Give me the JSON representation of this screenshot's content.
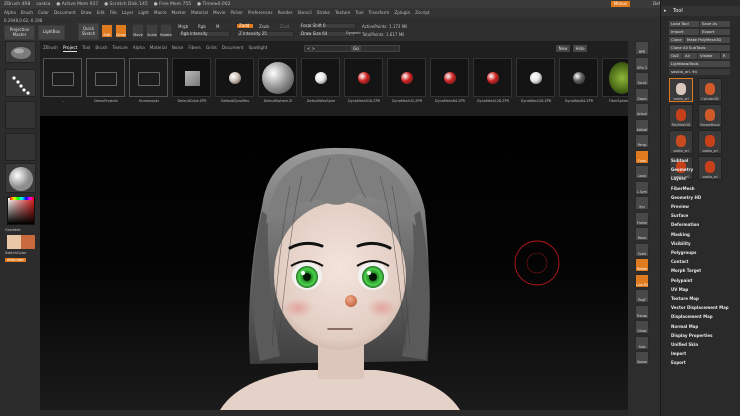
{
  "titlebar": {
    "items": [
      "ZBrush 4R8",
      "saskia",
      "● Active Mem 937",
      "● Scratch Disk 145",
      "● Free Mem 755",
      "● Timer▸0.002"
    ],
    "menus_label": "Menus",
    "script_label": "DefaultZScript"
  },
  "menubar": [
    "Alpha",
    "Brush",
    "Color",
    "Document",
    "Draw",
    "Edit",
    "File",
    "Layer",
    "Light",
    "Macro",
    "Marker",
    "Material",
    "Movie",
    "Picker",
    "Preferences",
    "Render",
    "Stencil",
    "Stroke",
    "Texture",
    "Tool",
    "Transform",
    "Zplugin",
    "Zscript"
  ],
  "shelf": {
    "coords": "0.2948,0.62,-0.198",
    "projection_master": "Projection Master",
    "lightbox": "LightBox",
    "quick_sketch": "Quick Sketch",
    "tools": [
      "Edit",
      "Draw",
      "Move",
      "Scale",
      "Rotate"
    ],
    "mrgb": "Mrgb",
    "rgb": "Rgb",
    "m": "M",
    "zadd": "Zadd",
    "zsub": "Zsub",
    "zcut": "Zcut",
    "rgb_intensity": "Rgb Intensity",
    "z_intensity": "Z Intensity 25",
    "focal_shift": "Focal Shift 0",
    "draw_size": "Draw Size 64",
    "active_points": "ActivePoints: 1.173 Mil",
    "total_points": "TotalPoints: 1.617 Mil",
    "dynamic": "Dynamic"
  },
  "left": {
    "gradient": "Gradient",
    "switch_color": "SwitchColor",
    "alternate": "Alternate"
  },
  "lightbox": {
    "tabs": [
      "ZBrush",
      "Project",
      "Tool",
      "Brush",
      "Texture",
      "Alpha",
      "Material",
      "Noise",
      "Fibers",
      "Grids",
      "Document",
      "Spotlight"
    ],
    "active_tab": "Project",
    "search": "< >",
    "go": "Go",
    "new": "New",
    "hide": "Hide",
    "thumbs": [
      {
        "label": "..",
        "kind": "folder"
      },
      {
        "label": "DemoProjects",
        "kind": "folder"
      },
      {
        "label": "Humanoyds",
        "kind": "folder"
      },
      {
        "label": "DefaultCube.ZPR",
        "kind": "cube"
      },
      {
        "label": "DefaultDynaMes",
        "kind": "ball",
        "color": "#cdbfb4"
      },
      {
        "label": "DefaultSphere.ZI",
        "kind": "bigball",
        "color": "#9c9c9c"
      },
      {
        "label": "DefaultWaxSphe",
        "kind": "ball",
        "color": "#e6e6e6"
      },
      {
        "label": "DynaMesh016.ZPR",
        "kind": "ball",
        "color": "#cc2020"
      },
      {
        "label": "DynaMesh32.ZPR",
        "kind": "ball",
        "color": "#cc2020"
      },
      {
        "label": "DynaMesh64.ZPR",
        "kind": "ball",
        "color": "#cc2020"
      },
      {
        "label": "DynaMesh128.ZPR",
        "kind": "ball",
        "color": "#cc2020"
      },
      {
        "label": "DynaWax128.ZPR",
        "kind": "ball",
        "color": "#e6e6e6"
      },
      {
        "label": "DynaWax64.ZPR",
        "kind": "ball",
        "color": "#5a5a5a"
      },
      {
        "label": "FiberSphere.ZP",
        "kind": "fiber"
      }
    ]
  },
  "rstrip": [
    "BPR",
    "SPix 3",
    "Scroll",
    "Zoom",
    "Actual",
    "AAHalf",
    "Persp",
    "Floor",
    "Local",
    "L.Sym",
    "Xyz",
    "Frame",
    "Move",
    "Scale",
    "Rotate",
    "Line Fill",
    "PolyF",
    "Transp",
    "Ghost",
    "Solo",
    "Xpose"
  ],
  "palette": {
    "title": "Tool",
    "buttons": [
      "Load Tool",
      "Save As",
      "Import",
      "Export",
      "Clone",
      "Make PolyMesh3D",
      "Clone All SubTools",
      "GoZ",
      "All",
      "Visible",
      "R",
      "Lightbox▸Tools"
    ],
    "current": "saskia_orl. 94",
    "tiles": [
      "saskia_orl",
      "Cylinder3D",
      "PolyMesh3D",
      "SimpleBrush",
      "saskia_orl",
      "saskia_orl",
      "saskia_orl",
      "saskia_orl"
    ],
    "subpalettes": [
      "Subtool",
      "Geometry",
      "Layers",
      "FiberMesh",
      "Geometry HD",
      "Preview",
      "Surface",
      "Deformation",
      "Masking",
      "Visibility",
      "Polygroups",
      "Contact",
      "Morph Target",
      "Polypaint",
      "UV Map",
      "Texture Map",
      "Vector Displacement Map",
      "Displacement Map",
      "Normal Map",
      "Display Properties",
      "Unified Skin",
      "Import",
      "Export"
    ]
  },
  "colors": {
    "accent": "#e07a1e",
    "eye": "#2fa82f",
    "skin": "#e9d8cf",
    "hair": "#6a6a6a",
    "nose": "#d88867"
  }
}
